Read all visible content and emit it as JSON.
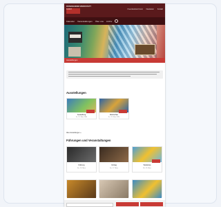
{
  "header": {
    "brand_line": "ROSENHEIMER WERKSTATT",
    "brand_badge": "KUNST",
    "links": [
      "Freundeskreis Kunst",
      "Newsletter",
      "Kontakt"
    ]
  },
  "nav": {
    "items": [
      "Kalender",
      "Veranstaltungen",
      "Über uns",
      "Archiv"
    ]
  },
  "hero": {
    "caption": "Ausstellungen"
  },
  "intro": {
    "text": ""
  },
  "section_current": {
    "title": "Ausstellungen"
  },
  "current_tiles": [
    {
      "title": "Ausstellung",
      "subtitle": "Di., 12. März 2024"
    },
    {
      "title": "Werkschau",
      "subtitle": "Fr., 15. März 2024"
    }
  ],
  "more_link": "Alle Ausstellungen »",
  "section_upcoming": {
    "title": "Führungen und Veranstaltungen"
  },
  "upcoming_tiles": [
    {
      "title": "Führung",
      "subtitle": "Sa., 16. März"
    },
    {
      "title": "Vortrag",
      "subtitle": "So., 17. März"
    },
    {
      "title": "Workshop",
      "subtitle": "Mi., 20. März"
    }
  ],
  "colors": {
    "header": "#5a1a1c",
    "accent": "#c83a35"
  }
}
